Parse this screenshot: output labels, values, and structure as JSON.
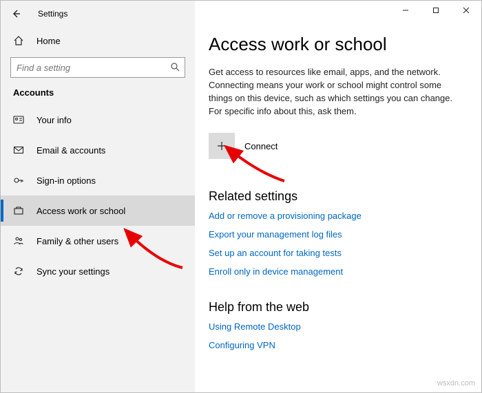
{
  "app_title": "Settings",
  "home_label": "Home",
  "search_placeholder": "Find a setting",
  "section": "Accounts",
  "nav": {
    "items": [
      {
        "id": "your-info",
        "label": "Your info"
      },
      {
        "id": "email",
        "label": "Email & accounts"
      },
      {
        "id": "signin",
        "label": "Sign-in options"
      },
      {
        "id": "work-school",
        "label": "Access work or school"
      },
      {
        "id": "family",
        "label": "Family & other users"
      },
      {
        "id": "sync",
        "label": "Sync your settings"
      }
    ]
  },
  "page": {
    "title": "Access work or school",
    "description": "Get access to resources like email, apps, and the network. Connecting means your work or school might control some things on this device, such as which settings you can change. For specific info about this, ask them.",
    "connect_label": "Connect"
  },
  "related": {
    "heading": "Related settings",
    "links": [
      "Add or remove a provisioning package",
      "Export your management log files",
      "Set up an account for taking tests",
      "Enroll only in device management"
    ]
  },
  "help": {
    "heading": "Help from the web",
    "links": [
      "Using Remote Desktop",
      "Configuring VPN"
    ]
  },
  "watermark": "wsxdn.com"
}
